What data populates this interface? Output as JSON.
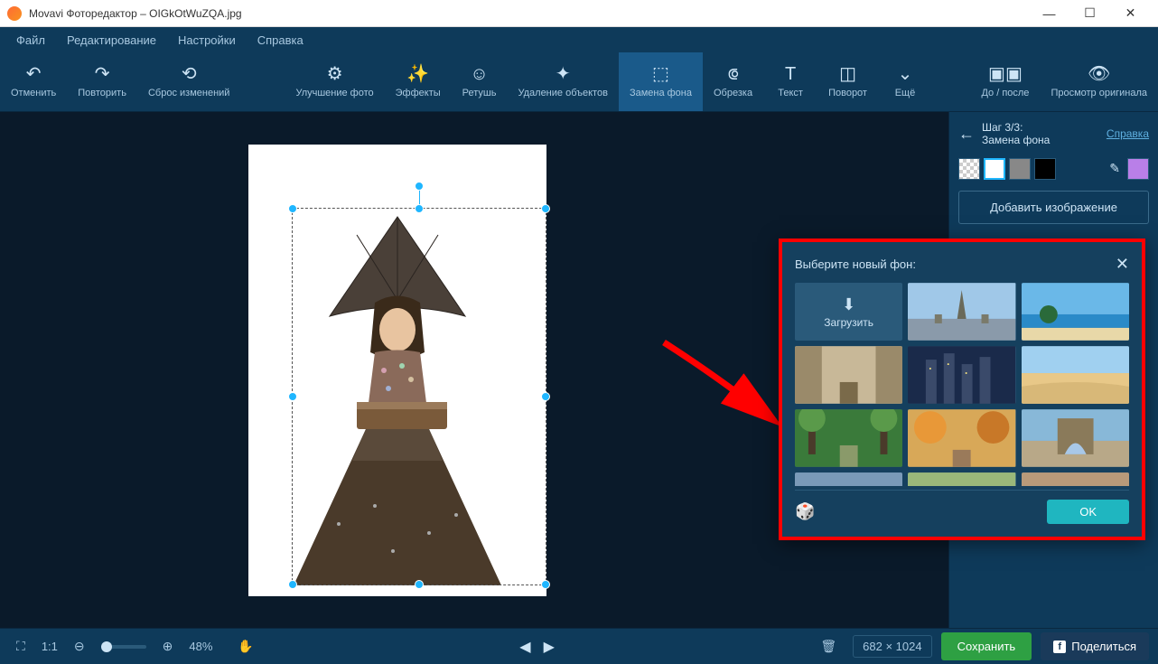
{
  "titlebar": {
    "app": "Movavi Фоторедактор",
    "sep": "–",
    "file": "OIGkOtWuZQA.jpg"
  },
  "menubar": {
    "items": [
      "Файл",
      "Редактирование",
      "Настройки",
      "Справка"
    ]
  },
  "toolbar": {
    "undo": "Отменить",
    "redo": "Повторить",
    "reset": "Сброс изменений",
    "enhance": "Улучшение фото",
    "effects": "Эффекты",
    "retouch": "Ретушь",
    "remove": "Удаление объектов",
    "bg": "Замена фона",
    "crop": "Обрезка",
    "text": "Текст",
    "rotate": "Поворот",
    "more": "Ещё",
    "before_after": "До / после",
    "compare": "Просмотр оригинала"
  },
  "panel": {
    "step_line1": "Шаг 3/3:",
    "step_line2": "Замена фона",
    "help": "Справка",
    "add_image": "Добавить изображение"
  },
  "popup": {
    "title": "Выберите новый фон:",
    "upload": "Загрузить",
    "ok": "OK"
  },
  "bottombar": {
    "ratio": "1:1",
    "zoom": "48%",
    "dims": "682 × 1024",
    "save": "Сохранить",
    "share": "Поделиться"
  }
}
